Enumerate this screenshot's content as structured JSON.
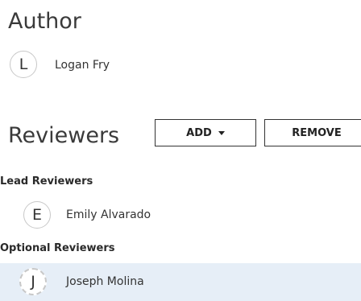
{
  "author": {
    "title": "Author",
    "person": {
      "initial": "L",
      "name": "Logan Fry"
    }
  },
  "reviewers": {
    "title": "Reviewers",
    "add_label": "ADD",
    "remove_label": "REMOVE",
    "lead": {
      "label": "Lead Reviewers",
      "people": [
        {
          "initial": "E",
          "name": "Emily Alvarado"
        }
      ]
    },
    "optional": {
      "label": "Optional Reviewers",
      "people": [
        {
          "initial": "J",
          "name": "Joseph Molina"
        }
      ]
    }
  },
  "colors": {
    "avatar_border": "#c8c8c8",
    "selected_row_bg": "#e6eef7",
    "button_border": "#333333"
  }
}
